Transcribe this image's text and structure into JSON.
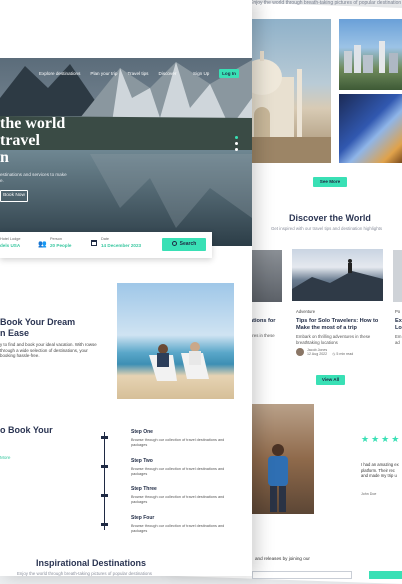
{
  "back_page": {
    "top_caption": "Enjoy the world through breath-taking pictures of popular destination",
    "see_more_label": "See More",
    "discover": {
      "title": "Discover the World",
      "subtitle": "Get inspired with our travel tips and destination highlights"
    },
    "articles": [
      {
        "tag": "",
        "title": "ations for",
        "desc": "ures in these",
        "meta": ""
      },
      {
        "tag": "Adventure",
        "title": "Tips for Solo Travelers: How to Make the most of a trip",
        "desc": "Embark on thrilling adventures in these breathtaking locations",
        "author": "Jacob Jones",
        "date": "12 Aug 2022",
        "read": "5 min read"
      },
      {
        "tag": "Po",
        "title": "Ex Lo",
        "desc": "Em ad",
        "meta": ""
      }
    ],
    "view_all_label": "View All",
    "testimonial": {
      "stars": "★★★★",
      "quote": "I had an amazing ex platform. Their rec and made my trip u",
      "author": "John Doe"
    },
    "newsletter_text": "and releases by joining our"
  },
  "front_page": {
    "nav": {
      "items": [
        "Explore destinations",
        "Plan your trip",
        "Travel tips",
        "Discover"
      ],
      "sign_up": "Sign Up",
      "log_in": "Log In"
    },
    "hero": {
      "title_line1": "the world",
      "title_line2": "travel",
      "title_line3": "n",
      "desc_line1": "estinations and services to make",
      "desc_line2": "e.",
      "book_now": "Book Now"
    },
    "search_bar": {
      "location_label": "Hotel Lodge",
      "location_value": "dels USA",
      "guests_label": "Person",
      "guests_value": "20 People",
      "date_label": "Date",
      "date_value": "14 December 2023",
      "search_label": "Search"
    },
    "book_section": {
      "title_line1": "Book Your Dream",
      "title_line2": "n Ease",
      "desc": "y to find and book your ideal vacation. With rowse through a wide selection of destinations, your booking hassle-free."
    },
    "steps_section": {
      "title": "o Book Your",
      "link": "More",
      "steps": [
        {
          "title": "Step One",
          "desc": "Browse through our collection of travel destinations and packages"
        },
        {
          "title": "Step Two",
          "desc": "Browse through our collection of travel destinations and packages"
        },
        {
          "title": "Step Three",
          "desc": "Browse through our collection of travel destinations and packages"
        },
        {
          "title": "Step Four",
          "desc": "Browse through our collection of travel destinations and packages"
        }
      ]
    },
    "inspirational": {
      "title": "Inspirational Destinations",
      "subtitle": "Enjoy the world through breath-taking pictures of popular destinations"
    }
  },
  "colors": {
    "accent": "#39e0b5",
    "text_dark": "#1f2a44"
  }
}
